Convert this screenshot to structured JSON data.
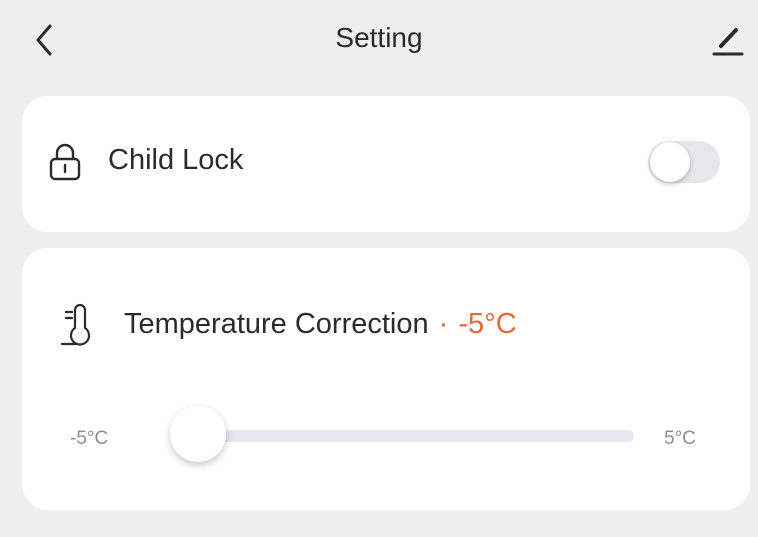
{
  "header": {
    "title": "Setting",
    "back_icon": "chevron-left-icon",
    "edit_icon": "pencil-icon"
  },
  "child_lock": {
    "icon": "lock-icon",
    "label": "Child Lock",
    "enabled": false
  },
  "temperature_correction": {
    "icon": "thermometer-icon",
    "label": "Temperature Correction",
    "separator": "·",
    "value": "-5°C",
    "slider": {
      "min_label": "-5°C",
      "max_label": "5°C",
      "min": -5,
      "max": 5,
      "current": -5
    }
  },
  "colors": {
    "accent": "#e8692f",
    "background": "#efefef",
    "card": "#ffffff",
    "track": "#e4e8ee"
  }
}
